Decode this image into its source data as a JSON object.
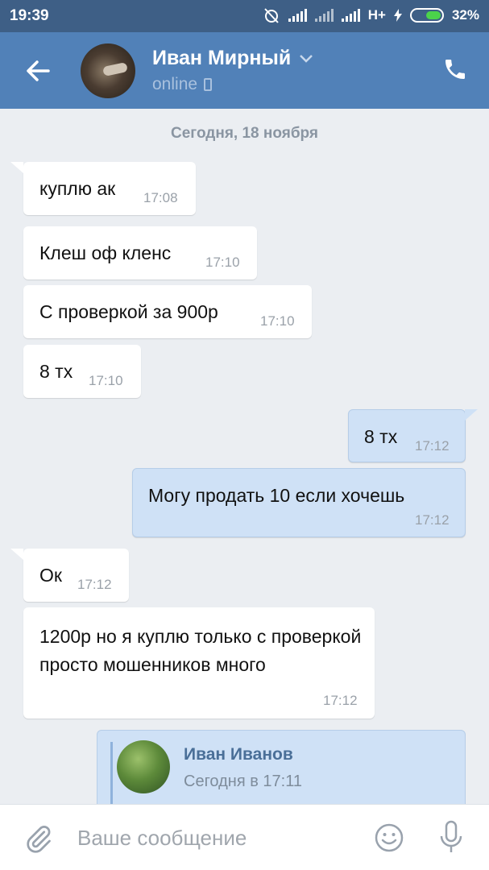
{
  "statusbar": {
    "time": "19:39",
    "network": "H+",
    "battery": "32%"
  },
  "header": {
    "name": "Иван Мирный",
    "status": "online"
  },
  "chat": {
    "date": "Сегодня, 18 ноября",
    "messages": [
      {
        "dir": "in",
        "text": "куплю ак",
        "time": "17:08"
      },
      {
        "dir": "in",
        "text": "Клеш оф кленс",
        "time": "17:10"
      },
      {
        "dir": "in",
        "text": "С проверкой за 900р",
        "time": "17:10"
      },
      {
        "dir": "in",
        "text": "8 тх",
        "time": "17:10"
      },
      {
        "dir": "out",
        "text": "8 тх",
        "time": "17:12"
      },
      {
        "dir": "out",
        "text": "Могу продать 10 если хочешь",
        "time": "17:12"
      },
      {
        "dir": "in",
        "text": "Ок",
        "time": "17:12"
      },
      {
        "dir": "in",
        "text": "1200р но я куплю только с проверкой просто мошенников много",
        "time": "17:12"
      }
    ],
    "forwarded": {
      "name": "Иван Иванов",
      "date": "Сегодня в 17:11"
    }
  },
  "input": {
    "placeholder": "Ваше сообщение"
  },
  "icons": [
    "back-arrow-icon",
    "chevron-down-icon",
    "mobile-icon",
    "call-icon",
    "attach-icon",
    "smile-icon",
    "mic-icon"
  ],
  "colors": {
    "header": "#5181b8",
    "statusbar": "#3e5f86",
    "background": "#ebeef2",
    "outgoing": "#cfe1f6"
  }
}
